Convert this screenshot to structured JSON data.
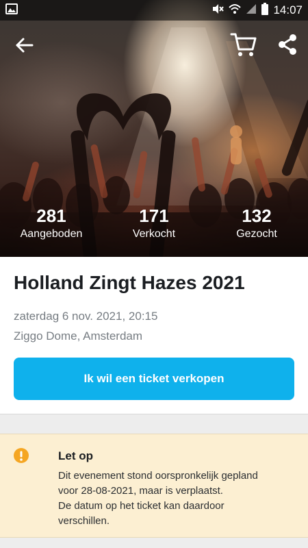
{
  "status_bar": {
    "time": "14:07",
    "icons": [
      "image-icon",
      "mute-icon",
      "wifi-icon",
      "signal-icon",
      "battery-icon"
    ]
  },
  "header": {
    "back_icon": "arrow-left-icon",
    "cart_icon": "cart-icon",
    "share_icon": "share-icon"
  },
  "stats": [
    {
      "value": "281",
      "label": "Aangeboden"
    },
    {
      "value": "171",
      "label": "Verkocht"
    },
    {
      "value": "132",
      "label": "Gezocht"
    }
  ],
  "event": {
    "title": "Holland Zingt Hazes 2021",
    "date": "zaterdag 6 nov. 2021, 20:15",
    "venue": "Ziggo Dome, Amsterdam",
    "sell_button": "Ik wil een ticket verkopen"
  },
  "notice": {
    "icon": "alert-icon",
    "title": "Let op",
    "lines": [
      "Dit evenement stond oorspronkelijk gepland",
      "voor 28-08-2021, maar is verplaatst.",
      "De datum op het ticket kan daardoor",
      "verschillen."
    ]
  },
  "colors": {
    "primary_button": "#0fb1ec",
    "notice_background": "#fcefd2",
    "notice_icon": "#f5a623"
  }
}
